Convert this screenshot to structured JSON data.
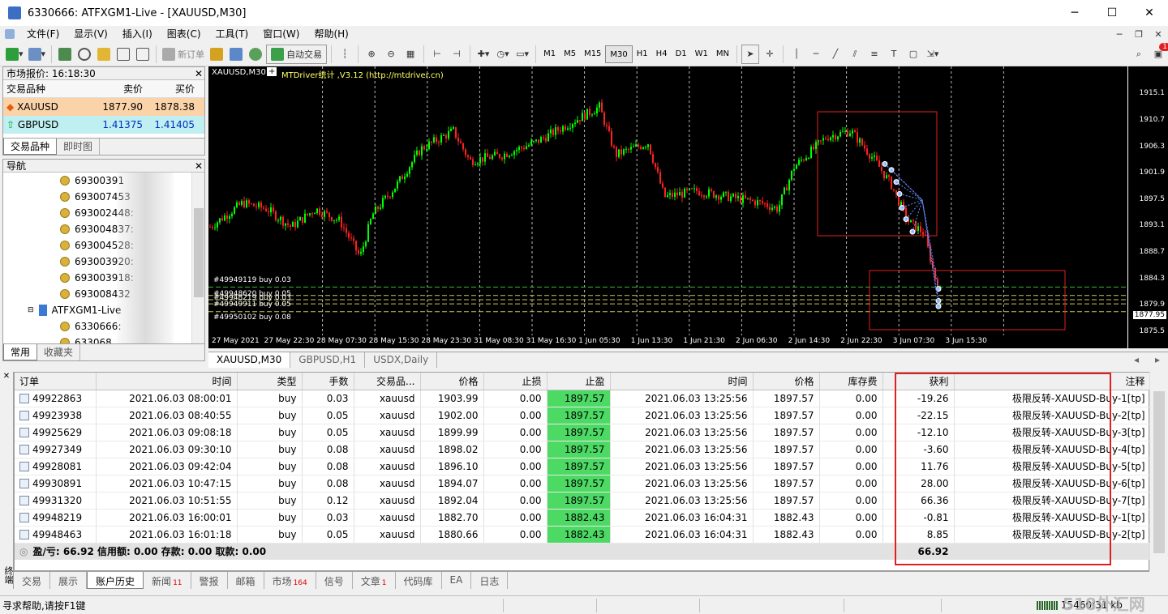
{
  "window": {
    "title": "6330666: ATFXGM1-Live - [XAUUSD,M30]",
    "minimize": "─",
    "maximize": "☐",
    "close": "✕"
  },
  "menu": [
    "文件(F)",
    "显示(V)",
    "插入(I)",
    "图表(C)",
    "工具(T)",
    "窗口(W)",
    "帮助(H)"
  ],
  "toolbar": {
    "new_order": "新订单",
    "auto_trade": "自动交易",
    "timeframes": [
      "M1",
      "M5",
      "M15",
      "M30",
      "H1",
      "H4",
      "D1",
      "W1",
      "MN"
    ],
    "active_tf": "M30",
    "indicator_T": "T",
    "notif_count": "1"
  },
  "market_watch": {
    "title": "市场报价: 16:18:30",
    "col_symbol": "交易品种",
    "col_bid": "卖价",
    "col_ask": "买价",
    "rows": [
      {
        "symbol": "XAUUSD",
        "bid": "1877.90",
        "ask": "1878.38",
        "color": "#fbd3a8"
      },
      {
        "symbol": "GBPUSD",
        "bid": "1.41375",
        "ask": "1.41405",
        "color": "#bfeff0"
      }
    ],
    "tabs": [
      "交易品种",
      "即时图"
    ]
  },
  "navigator": {
    "title": "导航",
    "items": [
      "69300391",
      "693007453",
      "693002448:",
      "693004837:",
      "693004528:",
      "693003920:",
      "693003918:",
      "693008432"
    ],
    "server": "ATFXGM1-Live",
    "sub_items": [
      "6330666:",
      "633068"
    ],
    "tabs": [
      "常用",
      "收藏夹"
    ]
  },
  "chart": {
    "label": "XAUUSD,M30",
    "indicator": "MTDriver统计 ,V3.12 (http://mtdriver.cn)",
    "bid_label": "1877.95",
    "order_labels": [
      "#49949119 buy 0.03",
      "#49948620 buy 0.05",
      "#49949911 buy 0.05",
      "#49950102 buy 0.08",
      "#49948219 buy 0.03"
    ],
    "chart_data": {
      "type": "candlestick",
      "symbol": "XAUUSD",
      "timeframe": "M30",
      "y_ticks": [
        1915.1,
        1910.7,
        1906.3,
        1901.9,
        1897.5,
        1893.1,
        1888.7,
        1884.3,
        1879.9,
        1875.5
      ],
      "ylim": [
        1875.5,
        1917.3
      ],
      "x_ticks": [
        "27 May 2021",
        "27 May 22:30",
        "28 May 07:30",
        "28 May 15:30",
        "28 May 23:30",
        "31 May 08:30",
        "31 May 16:30",
        "1 Jun 05:30",
        "1 Jun 13:30",
        "1 Jun 21:30",
        "2 Jun 06:30",
        "2 Jun 14:30",
        "2 Jun 22:30",
        "3 Jun 07:30",
        "3 Jun 15:30"
      ],
      "bull_color": "#00ff00",
      "bear_color": "#ff2020",
      "grid": true
    }
  },
  "chart_tabs": [
    "XAUUSD,M30",
    "GBPUSD,H1",
    "USDX,Daily"
  ],
  "terminal": {
    "side_label": "终端",
    "headers": [
      "订单",
      "时间",
      "类型",
      "手数",
      "交易品...",
      "价格",
      "止损",
      "止盈",
      "时间",
      "价格",
      "库存费",
      "获利",
      "注释"
    ],
    "rows": [
      [
        "49922863",
        "2021.06.03 08:00:01",
        "buy",
        "0.03",
        "xauusd",
        "1903.99",
        "0.00",
        "1897.57",
        "2021.06.03 13:25:56",
        "1897.57",
        "0.00",
        "-19.26",
        "极限反转-XAUUSD-Buy-1[tp]"
      ],
      [
        "49923938",
        "2021.06.03 08:40:55",
        "buy",
        "0.05",
        "xauusd",
        "1902.00",
        "0.00",
        "1897.57",
        "2021.06.03 13:25:56",
        "1897.57",
        "0.00",
        "-22.15",
        "极限反转-XAUUSD-Buy-2[tp]"
      ],
      [
        "49925629",
        "2021.06.03 09:08:18",
        "buy",
        "0.05",
        "xauusd",
        "1899.99",
        "0.00",
        "1897.57",
        "2021.06.03 13:25:56",
        "1897.57",
        "0.00",
        "-12.10",
        "极限反转-XAUUSD-Buy-3[tp]"
      ],
      [
        "49927349",
        "2021.06.03 09:30:10",
        "buy",
        "0.08",
        "xauusd",
        "1898.02",
        "0.00",
        "1897.57",
        "2021.06.03 13:25:56",
        "1897.57",
        "0.00",
        "-3.60",
        "极限反转-XAUUSD-Buy-4[tp]"
      ],
      [
        "49928081",
        "2021.06.03 09:42:04",
        "buy",
        "0.08",
        "xauusd",
        "1896.10",
        "0.00",
        "1897.57",
        "2021.06.03 13:25:56",
        "1897.57",
        "0.00",
        "11.76",
        "极限反转-XAUUSD-Buy-5[tp]"
      ],
      [
        "49930891",
        "2021.06.03 10:47:15",
        "buy",
        "0.08",
        "xauusd",
        "1894.07",
        "0.00",
        "1897.57",
        "2021.06.03 13:25:56",
        "1897.57",
        "0.00",
        "28.00",
        "极限反转-XAUUSD-Buy-6[tp]"
      ],
      [
        "49931320",
        "2021.06.03 10:51:55",
        "buy",
        "0.12",
        "xauusd",
        "1892.04",
        "0.00",
        "1897.57",
        "2021.06.03 13:25:56",
        "1897.57",
        "0.00",
        "66.36",
        "极限反转-XAUUSD-Buy-7[tp]"
      ],
      [
        "49948219",
        "2021.06.03 16:00:01",
        "buy",
        "0.03",
        "xauusd",
        "1882.70",
        "0.00",
        "1882.43",
        "2021.06.03 16:04:31",
        "1882.43",
        "0.00",
        "-0.81",
        "极限反转-XAUUSD-Buy-1[tp]"
      ],
      [
        "49948463",
        "2021.06.03 16:01:18",
        "buy",
        "0.05",
        "xauusd",
        "1880.66",
        "0.00",
        "1882.43",
        "2021.06.03 16:04:31",
        "1882.43",
        "0.00",
        "8.85",
        "极限反转-XAUUSD-Buy-2[tp]"
      ]
    ],
    "summary": "盈/亏: 66.92  信用额: 0.00  存款: 0.00  取款: 0.00",
    "summary_profit": "66.92",
    "tabs": [
      {
        "label": "交易",
        "badge": ""
      },
      {
        "label": "展示",
        "badge": ""
      },
      {
        "label": "账户历史",
        "badge": ""
      },
      {
        "label": "新闻",
        "badge": "11"
      },
      {
        "label": "警报",
        "badge": ""
      },
      {
        "label": "邮箱",
        "badge": ""
      },
      {
        "label": "市场",
        "badge": "164"
      },
      {
        "label": "信号",
        "badge": ""
      },
      {
        "label": "文章",
        "badge": "1"
      },
      {
        "label": "代码库",
        "badge": ""
      },
      {
        "label": "EA",
        "badge": ""
      },
      {
        "label": "日志",
        "badge": ""
      }
    ],
    "active_tab": "账户历史"
  },
  "status": {
    "help": "寻求帮助,请按F1键",
    "traffic": "15460/31 kb",
    "watermark": "518外汇网"
  },
  "colors": {
    "highlight_box": "#e02020",
    "tp_cell": "#4cd964"
  }
}
